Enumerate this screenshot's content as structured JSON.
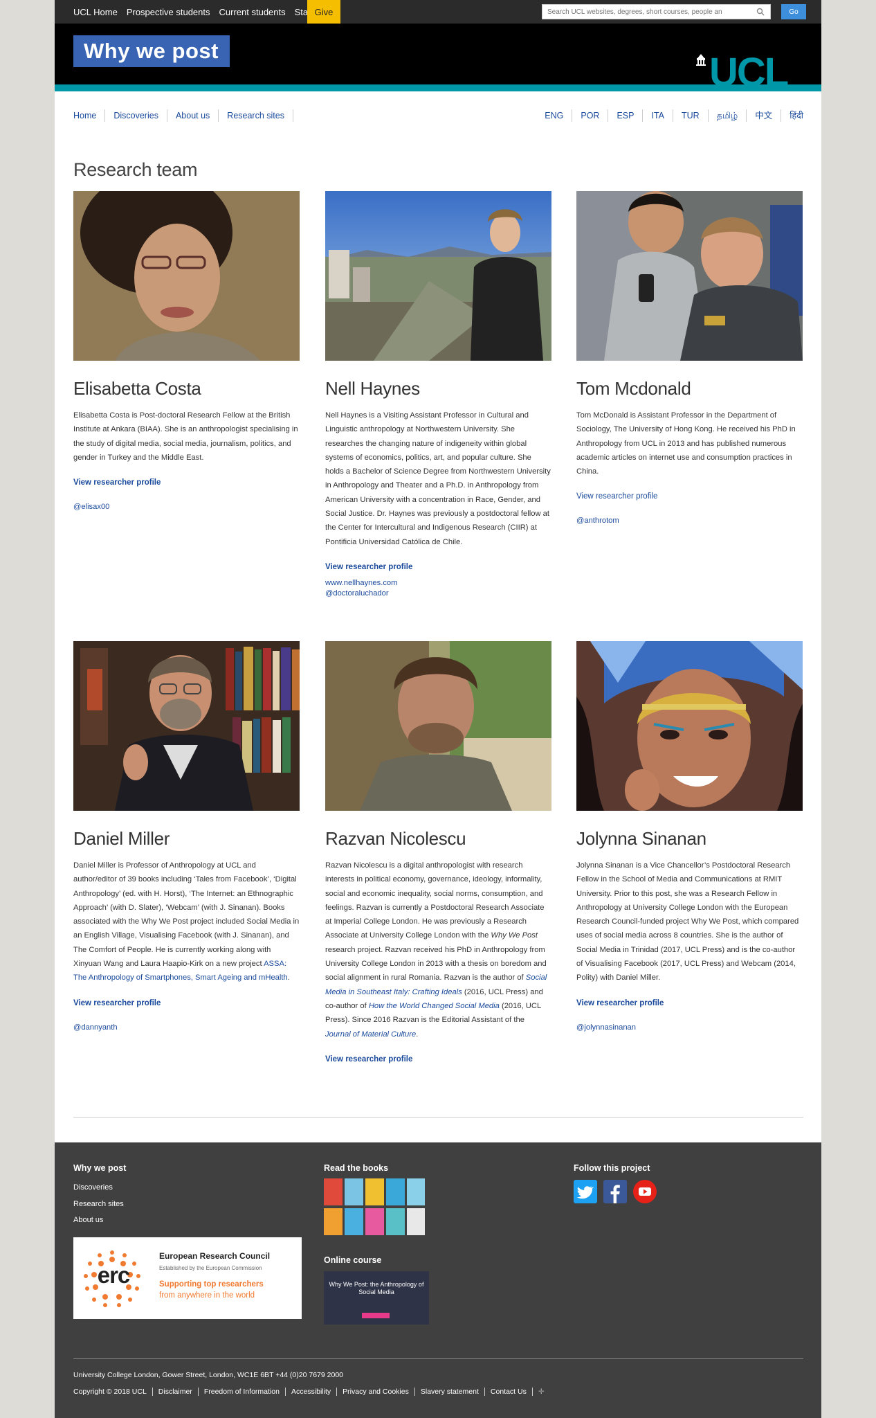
{
  "topbar": {
    "links": [
      "UCL Home",
      "Prospective students",
      "Current students",
      "Staff"
    ],
    "give": "Give",
    "search_placeholder": "Search UCL websites, degrees, short courses, people an",
    "go": "Go"
  },
  "header": {
    "site_title": "Why we post",
    "logo_text": "UCL"
  },
  "nav": {
    "left": [
      "Home",
      "Discoveries",
      "About us",
      "Research sites"
    ],
    "languages": [
      "ENG",
      "POR",
      "ESP",
      "ITA",
      "TUR",
      "தமிழ்",
      "中文",
      "हिंदी"
    ]
  },
  "page_title": "Research team",
  "team": [
    {
      "name": "Elisabetta Costa",
      "bio": "Elisabetta Costa is Post-doctoral Research Fellow at the British Institute at Ankara (BIAA). She is an anthropologist specialising in the study of digital media, social media, journalism, politics, and gender in Turkey and the Middle East.",
      "profile": "View researcher profile",
      "links": [
        "@elisax00"
      ]
    },
    {
      "name": "Nell Haynes",
      "bio": "Nell Haynes is a Visiting Assistant Professor in Cultural and Linguistic anthropology at Northwestern University. She researches the changing nature of indigeneity within global systems of economics, politics, art, and popular culture. She holds a Bachelor of Science Degree from Northwestern University in Anthropology and Theater and a Ph.D. in Anthropology from American University with a concentration in Race, Gender, and Social Justice. Dr. Haynes was previously a postdoctoral fellow at the Center for Intercultural and Indigenous Research (CIIR) at Pontificia Universidad Católica de Chile.",
      "profile": "View researcher profile",
      "links": [
        "www.nellhaynes.com",
        "@doctoraluchador"
      ]
    },
    {
      "name": "Tom Mcdonald",
      "bio": "Tom McDonald is Assistant Professor in the Department of Sociology, The University of Hong Kong. He received his PhD in Anthropology from UCL in 2013 and has published numerous academic articles on internet use and consumption practices in China.",
      "profile": "View researcher profile",
      "links": [
        "@anthrotom"
      ]
    },
    {
      "name": "Daniel Miller",
      "bio_pre": "Daniel Miller is Professor of Anthropology at UCL and author/editor of 39 books including ‘Tales from Facebook’, ‘Digital Anthropology’ (ed. with H. Horst), ‘The Internet: an Ethnographic Approach’ (with D. Slater), ‘Webcam’ (with J. Sinanan). Books associated with the Why We Post project included Social Media in an English Village, Visualising Facebook (with J. Sinanan), and The Comfort of People. He is currently working along with Xinyuan Wang and Laura Haapio-Kirk on a new project ",
      "bio_link": "ASSA: The Anthropology of Smartphones, Smart Ageing and mHealth",
      "bio_post": ".",
      "profile": "View researcher profile",
      "links": [
        "@dannyanth"
      ]
    },
    {
      "name": "Razvan Nicolescu",
      "bio_a": "Razvan Nicolescu is a digital anthropologist with research interests in political economy, governance, ideology, informality, social and economic inequality, social norms, consumption, and feelings. Razvan is currently a Postdoctoral Research Associate at Imperial College London. He was previously a Research Associate at University College London with the ",
      "bio_i1": "Why We Post",
      "bio_b": " research project. Razvan received his PhD in Anthropology from University College London in 2013 with a thesis on boredom and social alignment in rural Romania. Razvan is the author of ",
      "bio_l1": "Social Media in Southeast Italy: Crafting Ideals",
      "bio_c": " (2016, UCL Press) and co-author of ",
      "bio_l2": "How the World Changed Social Media",
      "bio_d": " (2016, UCL Press). Since 2016 Razvan is the Editorial Assistant of the ",
      "bio_l3": "Journal of Material Culture",
      "bio_e": ".",
      "profile": "View researcher profile"
    },
    {
      "name": "Jolynna Sinanan",
      "bio": "Jolynna Sinanan is a Vice Chancellor’s Postdoctoral Research Fellow in the School of Media and Communications at RMIT University. Prior to this post, she was a Research Fellow in Anthropology at University College London with the European Research Council-funded project Why We Post, which compared uses of social media across 8 countries. She is the author of Social Media in Trinidad (2017, UCL Press) and is the co-author of Visualising Facebook (2017, UCL Press) and Webcam (2014, Polity) with Daniel Miller.",
      "profile": "View researcher profile",
      "links": [
        "@jolynnasinanan"
      ]
    }
  ],
  "footer": {
    "col1_title": "Why we post",
    "col1_links": [
      "Discoveries",
      "Research sites",
      "About us"
    ],
    "erc": {
      "logo": "erc",
      "name": "European Research Council",
      "sub": "Established by the European Commission",
      "tag1": "Supporting top researchers",
      "tag2": "from anywhere in the world"
    },
    "col2_title": "Read the books",
    "course_title": "Online course",
    "course_text": "Why We Post: the Anthropology of Social Media",
    "col3_title": "Follow this project",
    "address": "University College London, Gower Street, London, WC1E 6BT +44 (0)20 7679 2000",
    "legal": [
      "Copyright © 2018 UCL",
      "Disclaimer",
      "Freedom of Information",
      "Accessibility",
      "Privacy and Cookies",
      "Slavery statement",
      "Contact Us"
    ],
    "colors": {
      "footer_bg": "#404040",
      "accent": "#0097a9",
      "link": "#1a4a9c",
      "give": "#f6be00"
    }
  }
}
